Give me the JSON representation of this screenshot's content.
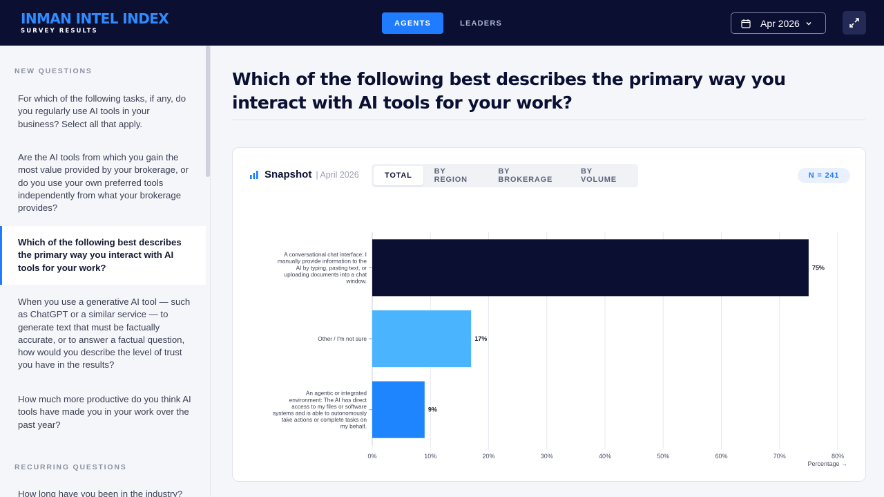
{
  "header": {
    "brand_title": "INMAN INTEL INDEX",
    "brand_sub": "SURVEY RESULTS",
    "tabs": [
      {
        "label": "AGENTS",
        "active": true
      },
      {
        "label": "LEADERS",
        "active": false
      }
    ],
    "date_label": "Apr 2026"
  },
  "sidebar": {
    "new_heading": "NEW QUESTIONS",
    "new_questions": [
      "For which of the following tasks, if any, do you regularly use AI tools in your business? Select all that apply.",
      "Are the AI tools from which you gain the most value provided by your brokerage, or do you use your own preferred tools independently from what your brokerage provides?",
      "Which of the following best describes the primary way you interact with AI tools for your work?",
      "When you use a generative AI tool — such as ChatGPT or a similar service — to generate text that must be factually accurate, or to answer a factual question, how would you describe the level of trust you have in the results?",
      "How much more productive do you think AI tools have made you in your work over the past year?"
    ],
    "recurring_heading": "RECURRING QUESTIONS",
    "recurring_questions": [
      "How long have you been in the industry?"
    ]
  },
  "main": {
    "title": "Which of the following best describes the primary way you interact with AI tools for your work?"
  },
  "card": {
    "snapshot_title": "Snapshot",
    "snapshot_date": "| April 2026",
    "tabs": [
      {
        "label": "TOTAL",
        "active": true
      },
      {
        "label": "BY REGION",
        "active": false
      },
      {
        "label": "BY BROKERAGE",
        "active": false
      },
      {
        "label": "BY VOLUME",
        "active": false
      }
    ],
    "n_label": "N = 241"
  },
  "chart_data": {
    "type": "bar",
    "orientation": "horizontal",
    "categories": [
      "A conversational chat interface: I manually provide information to the AI by typing, pasting text, or uploading documents into a chat window.",
      "Other / I'm not sure",
      "An agentic or integrated environment: The AI has direct access to my files or software systems and is able to autonomously take actions or complete tasks on my behalf."
    ],
    "category_lines": [
      [
        "A conversational chat interface: I",
        "manually provide information to the",
        "AI by typing, pasting text, or",
        "uploading documents into a chat",
        "window."
      ],
      [
        "Other / I'm not sure"
      ],
      [
        "An agentic or integrated",
        "environment: The AI has direct",
        "access to my files or software",
        "systems and is able to autonomously",
        "take actions or complete tasks on",
        "my behalf."
      ]
    ],
    "values": [
      75,
      17,
      9
    ],
    "value_labels": [
      "75%",
      "17%",
      "9%"
    ],
    "colors": [
      "#0b1033",
      "#4ab4ff",
      "#1f85ff"
    ],
    "xlim": [
      0,
      80
    ],
    "x_ticks": [
      0,
      10,
      20,
      30,
      40,
      50,
      60,
      70,
      80
    ],
    "x_tick_labels": [
      "0%",
      "10%",
      "20%",
      "30%",
      "40%",
      "50%",
      "60%",
      "70%",
      "80%"
    ],
    "xlabel": "Percentage →",
    "grid": true
  }
}
